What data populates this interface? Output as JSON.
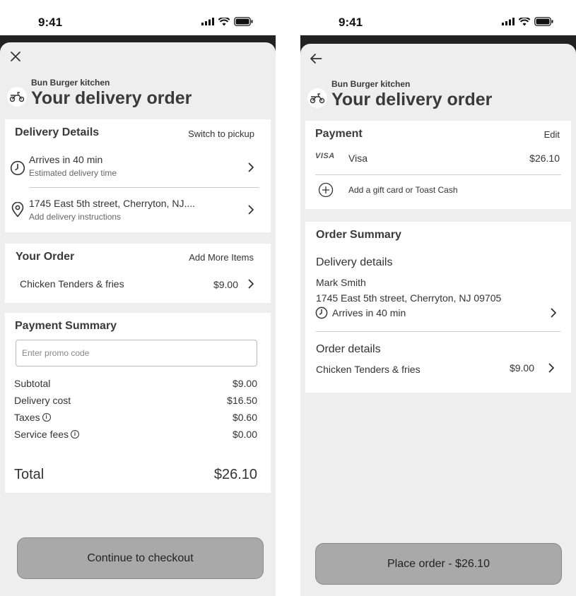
{
  "status_time": "9:41",
  "left_screen": {
    "restaurant": "Bun Burger kitchen",
    "title": "Your delivery order",
    "delivery_details": {
      "title": "Delivery Details",
      "switch_label": "Switch to pickup",
      "eta_main": "Arrives in 40 min",
      "eta_sub": "Estimated delivery time",
      "address_main": "1745 East 5th street, Cherryton, NJ....",
      "address_sub": "Add delivery instructions"
    },
    "your_order": {
      "title": "Your Order",
      "add_more": "Add More Items",
      "item_name": "Chicken Tenders & fries",
      "item_price": "$9.00"
    },
    "payment_summary": {
      "title": "Payment Summary",
      "promo_placeholder": "Enter promo code",
      "rows": [
        {
          "label": "Subtotal",
          "value": "$9.00"
        },
        {
          "label": "Delivery cost",
          "value": "$16.50"
        },
        {
          "label": "Taxes",
          "value": "$0.60"
        },
        {
          "label": "Service fees",
          "value": "$0.00"
        }
      ],
      "total_label": "Total",
      "total_value": "$26.10"
    },
    "cta": "Continue to checkout"
  },
  "right_screen": {
    "restaurant": "Bun Burger kitchen",
    "title": "Your delivery order",
    "payment": {
      "title": "Payment",
      "edit": "Edit",
      "card_brand": "VISA",
      "card_name": "Visa",
      "card_amount": "$26.10",
      "gift_label": "Add a gift card or Toast Cash"
    },
    "order_summary": {
      "title": "Order Summary",
      "delivery_title": "Delivery details",
      "name": "Mark Smith",
      "address": "1745 East 5th street, Cherryton, NJ 09705",
      "eta": "Arrives in 40 min",
      "order_title": "Order details",
      "item_name": "Chicken Tenders & fries",
      "item_price": "$9.00"
    },
    "cta": "Place order - $26.10"
  },
  "icons": {
    "close": "close-icon",
    "back": "back-arrow-icon",
    "scooter": "scooter-icon",
    "clock": "clock-icon",
    "pin": "location-pin-icon",
    "chevron": "chevron-right-icon",
    "info": "info-icon",
    "plus": "plus-circle-icon",
    "visa": "visa-card-icon"
  },
  "colors": {
    "sheet_bg": "#eeeeee",
    "card_bg": "#ffffff",
    "cta_bg": "#a9a9a9",
    "dark_band": "#222222"
  }
}
